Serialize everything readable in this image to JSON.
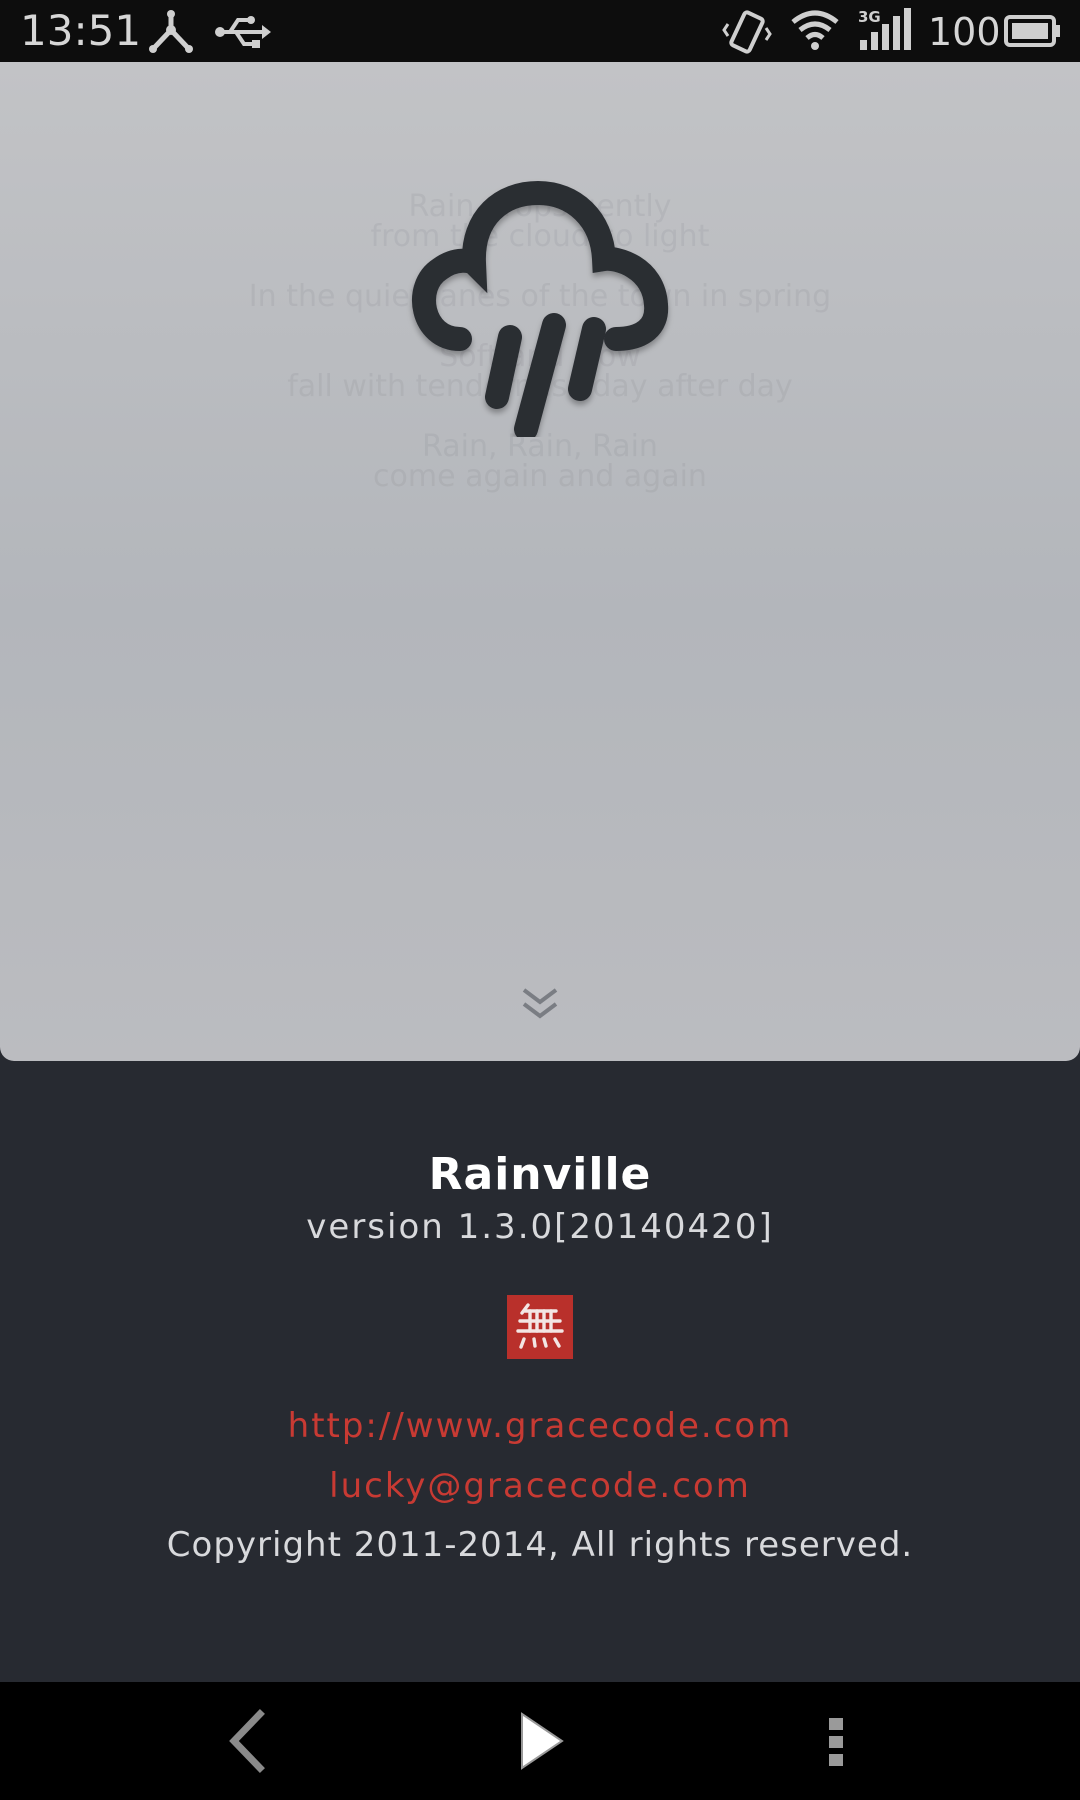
{
  "status_bar": {
    "time": "13:51",
    "network_type": "3G",
    "battery_percent": "100",
    "icons": [
      "share-icon",
      "usb-icon",
      "vibrate-icon",
      "wifi-icon",
      "signal-icon",
      "battery-icon"
    ]
  },
  "hero": {
    "poem": [
      [
        "Rain drops gently",
        "from the cloud so light"
      ],
      [
        "In the quiet lanes of the town in spring"
      ],
      [
        "Soft and slow",
        "fall with tenderness day after day"
      ],
      [
        "Rain, Rain, Rain",
        "come again and again"
      ]
    ],
    "icons": [
      "rain-cloud-icon",
      "chevron-double-down-icon"
    ]
  },
  "about": {
    "app_name": "Rainville",
    "version": "version 1.3.0[20140420]",
    "logo_glyph": "無",
    "website": "http://www.gracecode.com",
    "email": "lucky@gracecode.com",
    "copyright": "Copyright 2011-2014, All rights reserved."
  },
  "nav_bar": {
    "icons": [
      "back-icon",
      "play-icon",
      "menu-icon"
    ]
  },
  "colors": {
    "accent_red": "#c83a33",
    "logo_red": "#b9302b",
    "panel_dark": "#272a31",
    "hero_gray": "#b8babe"
  }
}
